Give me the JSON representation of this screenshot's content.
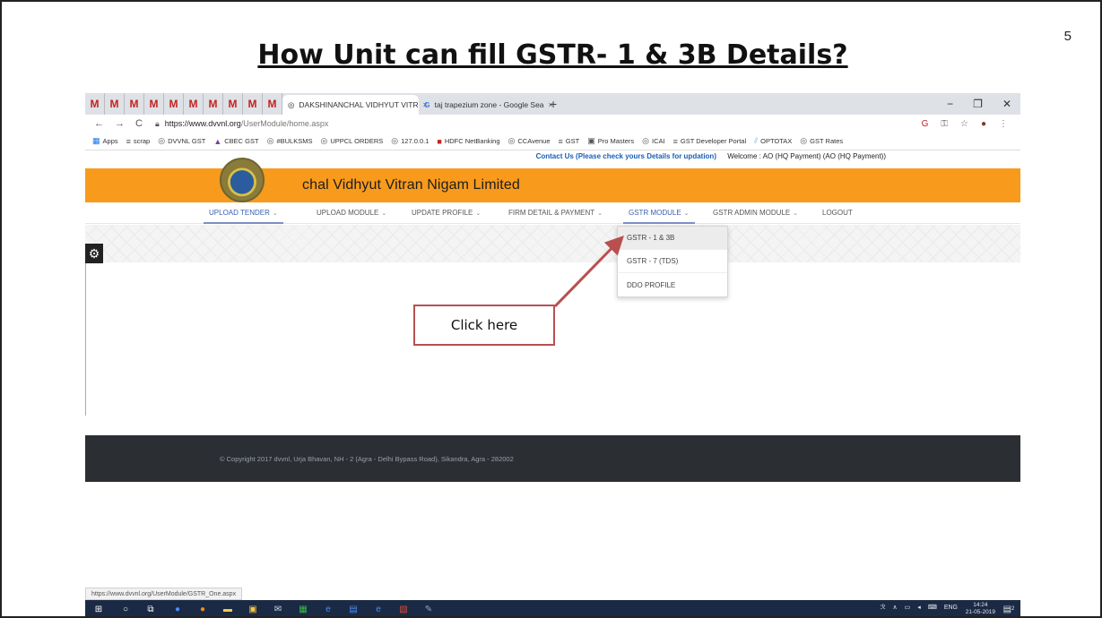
{
  "slide": {
    "title": "How Unit can fill GSTR- 1 & 3B Details?",
    "number": "5"
  },
  "browser": {
    "gmail_tab_glyph": "M",
    "tabs": [
      {
        "title": "DAKSHINANCHAL VIDHYUT VITR",
        "close": "×"
      },
      {
        "title": "taj trapezium zone - Google Sea",
        "close": "×"
      }
    ],
    "new_tab": "+",
    "window_controls": {
      "minimize": "−",
      "maximize": "❐",
      "close": "✕"
    },
    "url": {
      "host": "https://www.dvvnl.org",
      "path": "/UserModule/home.aspx"
    },
    "bookmarks": [
      "Apps",
      "scrap",
      "DVVNL GST",
      "CBEC GST",
      "#BULKSMS",
      "UPPCL ORDERS",
      "127.0.0.1",
      "HDFC NetBanking",
      "CCAvenue",
      "GST",
      "Pro Masters",
      "ICAI",
      "GST Developer Portal",
      "OPTOTAX",
      "GST Rates"
    ],
    "status_url": "https://www.dvvnl.org/UserModule/GSTR_One.aspx"
  },
  "site": {
    "contact_text": "Contact Us (Please check yours Details for updation)",
    "welcome_text": "Welcome : AO (HQ Payment) (AO (HQ Payment))",
    "org_name": "chal Vidhyut Vitran Nigam Limited",
    "menu": {
      "upload_tender": "UPLOAD TENDER",
      "upload_module": "UPLOAD MODULE",
      "update_profile": "UPDATE PROFILE",
      "firm_detail": "FIRM DETAIL & PAYMENT",
      "gstr_module": "GSTR MODULE",
      "gstr_admin": "GSTR ADMIN MODULE",
      "logout": "LOGOUT"
    },
    "dropdown": [
      "GSTR - 1 & 3B",
      "GSTR - 7 (TDS)",
      "DDO PROFILE"
    ],
    "footer": "© Copyright 2017 dvvnl, Urja Bhavan, NH - 2 (Agra - Delhi Bypass Road), Sikandra, Agra - 282002"
  },
  "taskbar": {
    "lang": "ENG",
    "time": "14:24",
    "date": "21-05-2019",
    "notification_count": "2"
  },
  "callout": {
    "label": "Click here"
  },
  "colors": {
    "banner": "#f89a1c",
    "footer": "#2b2e33",
    "active_menu": "#3a5fb0",
    "callout_border": "#b8504f",
    "taskbar": "#1b2a44"
  }
}
